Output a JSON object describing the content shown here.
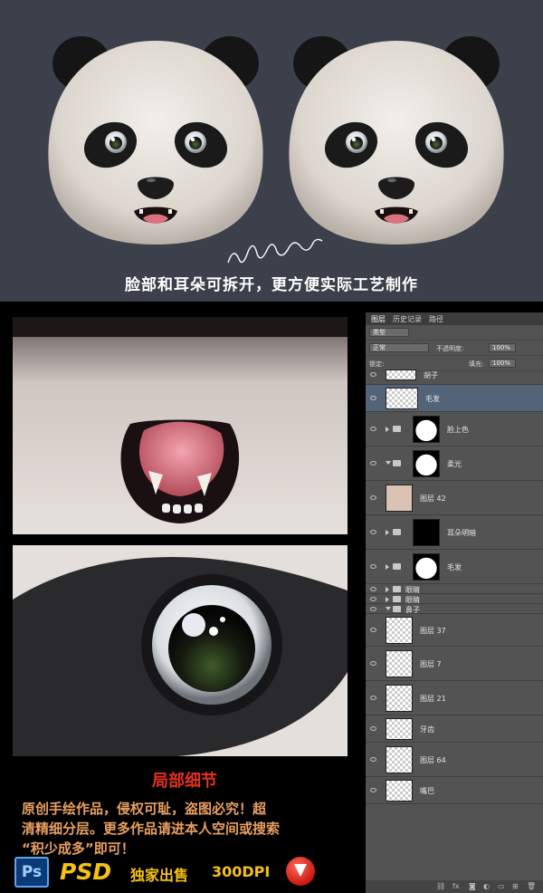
{
  "top_caption": "脸部和耳朵可拆开，更方便实际工艺制作",
  "signature": "青阳幽草",
  "credits": {
    "heading": "局部细节",
    "line1": "原创手绘作品，侵权可耻，盗图必究！超",
    "line2": "清精细分层。更多作品请进本人空间或搜索",
    "line3": "“积少成多”即可！"
  },
  "brand": {
    "ps": "Ps",
    "psd": "PSD",
    "exclusive": "独家出售",
    "dpi": "300DPI"
  },
  "panel": {
    "tabs": [
      "图层",
      "历史记录",
      "路径"
    ],
    "kind_filter": "类型",
    "blend_mode": "正常",
    "opacity_label": "不透明度:",
    "opacity_value": "100%",
    "lock_label": "锁定:",
    "fill_label": "填充:",
    "fill_value": "100%",
    "layers": [
      {
        "name": "胡子",
        "type": "layer"
      },
      {
        "name": "毛发",
        "type": "layer",
        "selected": true
      },
      {
        "name": "脸上色",
        "type": "group"
      },
      {
        "name": "柔光",
        "type": "group-open"
      },
      {
        "name": "图层 42",
        "type": "layer"
      },
      {
        "name": "耳朵明暗",
        "type": "group"
      },
      {
        "name": "毛发",
        "type": "group"
      },
      {
        "name": "眼睛",
        "type": "group-small"
      },
      {
        "name": "眼睛",
        "type": "group-small"
      },
      {
        "name": "鼻子",
        "type": "group-small-open"
      },
      {
        "name": "图层 37",
        "type": "layer"
      },
      {
        "name": "图层 7",
        "type": "layer"
      },
      {
        "name": "图层 21",
        "type": "layer"
      },
      {
        "name": "牙齿",
        "type": "layer"
      },
      {
        "name": "图层 64",
        "type": "layer"
      },
      {
        "name": "嘴巴",
        "type": "layer"
      }
    ]
  },
  "colors": {
    "top_bg": "#3b404b",
    "credits_text": "#e8a062",
    "credits_heading": "#e33120",
    "brand_yellow": "#f5c212"
  }
}
